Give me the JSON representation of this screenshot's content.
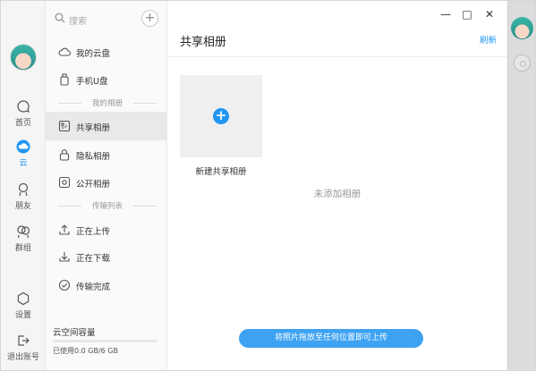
{
  "nav": {
    "items": [
      {
        "name": "home",
        "label": "首页"
      },
      {
        "name": "cloud",
        "label": "云"
      },
      {
        "name": "friends",
        "label": "朋友"
      },
      {
        "name": "groups",
        "label": "群组"
      },
      {
        "name": "settings",
        "label": "设置"
      },
      {
        "name": "logout",
        "label": "退出账号"
      }
    ],
    "active": "cloud"
  },
  "sidebar": {
    "search_placeholder": "搜索",
    "items": [
      {
        "label": "我的云盘"
      },
      {
        "label": "手机U盘"
      },
      {
        "label": "共享相册"
      },
      {
        "label": "隐私相册"
      },
      {
        "label": "公开相册"
      },
      {
        "label": "正在上传"
      },
      {
        "label": "正在下载"
      },
      {
        "label": "传输完成"
      }
    ],
    "sections": {
      "albums": "我的相册",
      "transfers": "传输列表"
    },
    "storage": {
      "title": "云空间容量",
      "usage_text": "已使用0.0 GB/6 GB",
      "used_fraction": 0.0
    }
  },
  "main": {
    "title": "共享相册",
    "refresh_label": "刷新",
    "new_album_label": "新建共享相册",
    "empty_text": "未添加相册",
    "upload_hint": "将照片拖放至任何位置即可上传"
  },
  "window": {
    "minimize": "—",
    "maximize": "□",
    "close": "✕"
  },
  "colors": {
    "accent": "#2196f3",
    "upload_button": "#3ea2f3"
  }
}
